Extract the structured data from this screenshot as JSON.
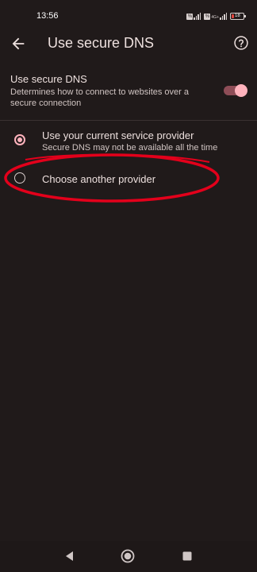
{
  "status_bar": {
    "time": "13:56",
    "network_label": "4G+",
    "battery_level": "18",
    "battery_color": "#e0443e"
  },
  "app_bar": {
    "title": "Use secure DNS",
    "back_icon": "arrow-back-icon",
    "help_icon": "help-circle-icon"
  },
  "secure_dns_toggle": {
    "title": "Use secure DNS",
    "description": "Determines how to connect to websites over a secure connection",
    "enabled": true
  },
  "options": [
    {
      "label": "Use your current service provider",
      "sublabel": "Secure DNS may not be available all the time",
      "selected": true
    },
    {
      "label": "Choose another provider",
      "selected": false
    }
  ],
  "annotation": {
    "shape": "ellipse",
    "color": "#e3001b",
    "target": "Choose another provider"
  },
  "nav_bar": {
    "buttons": [
      "back-triangle-icon",
      "home-circle-icon",
      "recents-square-icon"
    ]
  },
  "colors": {
    "background": "#201a1a",
    "accent": "#ffb3bd",
    "switch_track": "#8e4d57"
  }
}
